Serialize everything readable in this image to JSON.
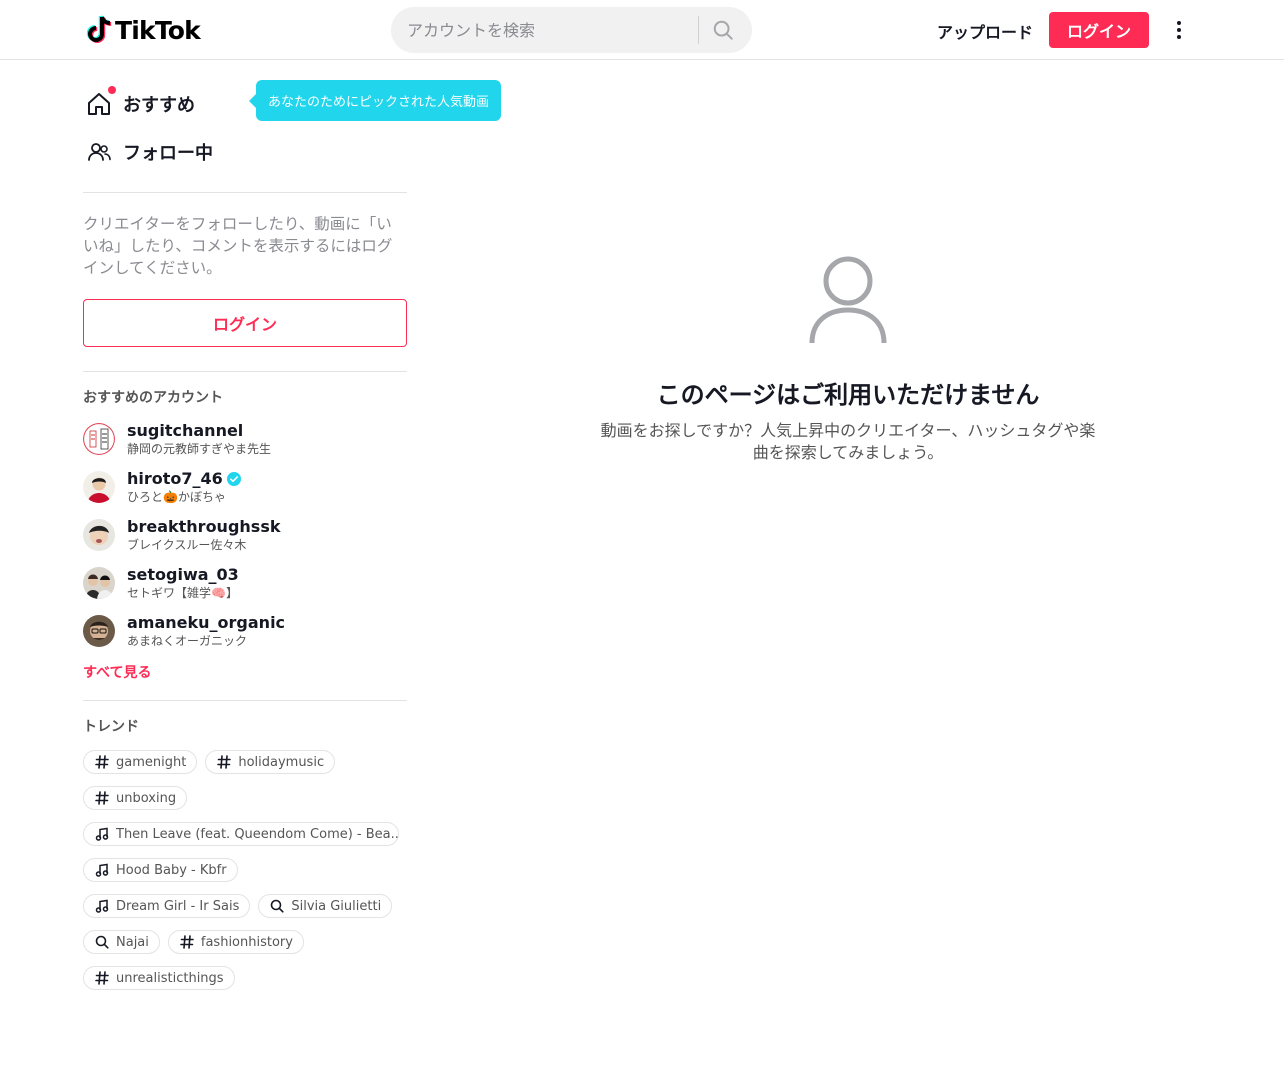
{
  "brand": {
    "name": "TikTok",
    "accent": "#fe2c55",
    "tooltip_color": "#20d5ec"
  },
  "header": {
    "search_placeholder": "アカウントを検索",
    "upload_label": "アップロード",
    "login_label": "ログイン"
  },
  "sidebar": {
    "nav": [
      {
        "label": "おすすめ",
        "icon": "home-icon"
      },
      {
        "label": "フォロー中",
        "icon": "users-icon"
      }
    ],
    "tooltip": "あなたのためにピックされた人気動画",
    "login_prompt": "クリエイターをフォローしたり、動画に「いいね」したり、コメントを表示するにはログインしてください。",
    "login_button": "ログイン",
    "suggested_title": "おすすめのアカウント",
    "accounts": [
      {
        "username": "sugitchannel",
        "display": "静岡の元教師すぎやま先生",
        "verified": false
      },
      {
        "username": "hiroto7_46",
        "display": "ひろと🎃かぼちゃ",
        "verified": true
      },
      {
        "username": "breakthroughssk",
        "display": "ブレイクスルー佐々木",
        "verified": false
      },
      {
        "username": "setogiwa_03",
        "display": "セトギワ【雑学🧠】",
        "verified": false
      },
      {
        "username": "amaneku_organic",
        "display": "あまねくオーガニック",
        "verified": false
      }
    ],
    "see_all": "すべて見る",
    "trending_title": "トレンド",
    "trending": [
      [
        {
          "type": "hashtag",
          "label": "gamenight"
        },
        {
          "type": "hashtag",
          "label": "holidaymusic"
        }
      ],
      [
        {
          "type": "hashtag",
          "label": "unboxing"
        }
      ],
      [
        {
          "type": "music",
          "label": "Then Leave (feat. Queendom Come) - Bea..."
        }
      ],
      [
        {
          "type": "music",
          "label": "Hood Baby - Kbfr"
        }
      ],
      [
        {
          "type": "music",
          "label": "Dream Girl - Ir Sais"
        },
        {
          "type": "search",
          "label": "Silvia Giulietti"
        }
      ],
      [
        {
          "type": "search",
          "label": "Najai"
        },
        {
          "type": "hashtag",
          "label": "fashionhistory"
        }
      ],
      [
        {
          "type": "hashtag",
          "label": "unrealisticthings"
        }
      ]
    ]
  },
  "main": {
    "title": "このページはご利用いただけません",
    "description": "動画をお探しですか？人気上昇中のクリエイター、ハッシュタグや楽曲を探索してみましょう。"
  }
}
